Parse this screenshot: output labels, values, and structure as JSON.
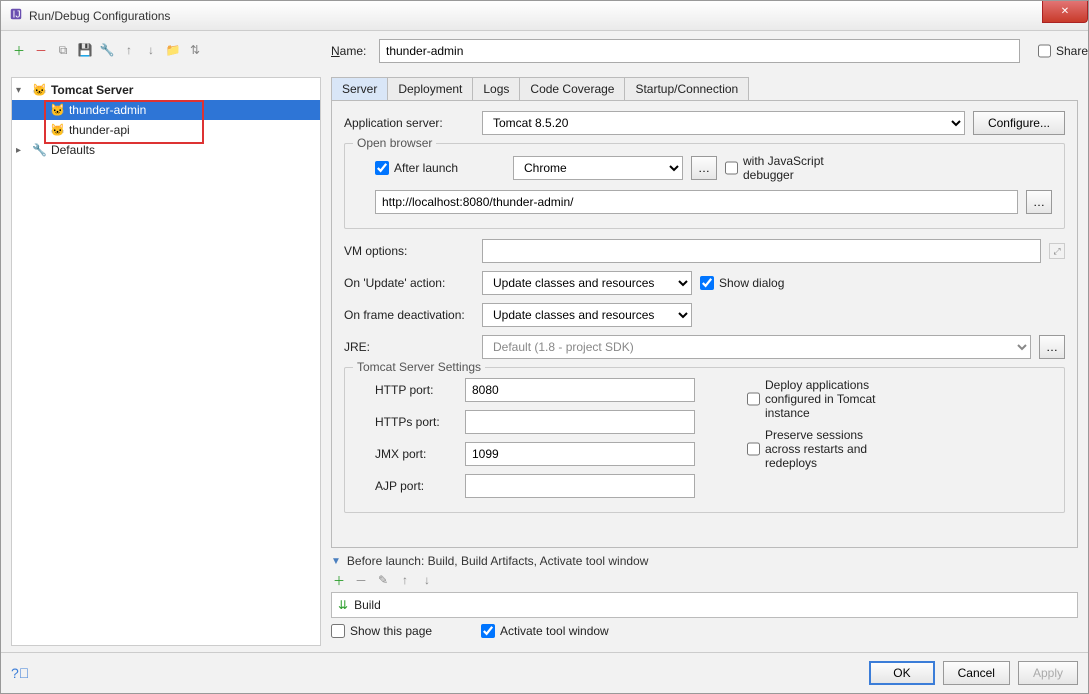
{
  "window": {
    "title": "Run/Debug Configurations"
  },
  "toolbar": {
    "items": [
      "add",
      "remove",
      "copy",
      "save-template",
      "wrench",
      "up",
      "down",
      "folder",
      "sort"
    ]
  },
  "tree": {
    "tomcat_label": "Tomcat Server",
    "children": [
      {
        "label": "thunder-admin",
        "selected": true
      },
      {
        "label": "thunder-api",
        "selected": false
      }
    ],
    "defaults_label": "Defaults"
  },
  "name_label": "Name:",
  "name_value": "thunder-admin",
  "share_label": "Share",
  "tabs": [
    "Server",
    "Deployment",
    "Logs",
    "Code Coverage",
    "Startup/Connection"
  ],
  "active_tab": 0,
  "server": {
    "app_server_label": "Application server:",
    "app_server_value": "Tomcat 8.5.20",
    "configure_btn": "Configure...",
    "open_browser_legend": "Open browser",
    "after_launch_label": "After launch",
    "browser_value": "Chrome",
    "with_js_label": "with JavaScript debugger",
    "url_value": "http://localhost:8080/thunder-admin/",
    "vm_options_label": "VM options:",
    "vm_options_value": "",
    "on_update_label": "On 'Update' action:",
    "on_update_value": "Update classes and resources",
    "show_dialog_label": "Show dialog",
    "on_frame_label": "On frame deactivation:",
    "on_frame_value": "Update classes and resources",
    "jre_label": "JRE:",
    "jre_value": "Default (1.8 - project SDK)",
    "tomcat_settings_legend": "Tomcat Server Settings",
    "http_port_label": "HTTP port:",
    "http_port_value": "8080",
    "https_port_label": "HTTPs port:",
    "https_port_value": "",
    "jmx_port_label": "JMX port:",
    "jmx_port_value": "1099",
    "ajp_port_label": "AJP port:",
    "ajp_port_value": "",
    "deploy_label": "Deploy applications configured in Tomcat instance",
    "preserve_label": "Preserve sessions across restarts and redeploys"
  },
  "before_launch": {
    "header": "Before launch: Build, Build Artifacts, Activate tool window",
    "item": "Build",
    "show_page_label": "Show this page",
    "activate_label": "Activate tool window"
  },
  "footer": {
    "ok": "OK",
    "cancel": "Cancel",
    "apply": "Apply"
  }
}
